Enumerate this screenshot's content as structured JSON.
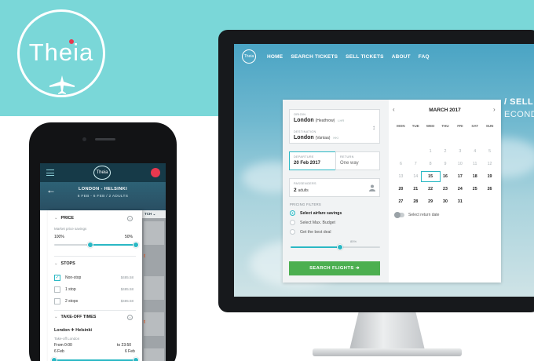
{
  "brand": {
    "logo_text": "Theia",
    "accent": "#2ab8c4",
    "band": "#7ad7d8",
    "cta": "#4caf50"
  },
  "desktop": {
    "nav": [
      "HOME",
      "SEARCH TICKETS",
      "SELL TICKETS",
      "ABOUT",
      "FAQ"
    ],
    "nav_logo": "Theia",
    "hero_line1": "/ SELL",
    "hero_line2": "ECONDA",
    "origin": {
      "label": "ORIGIN",
      "city": "London",
      "airport": "(Heathrow)",
      "code": "LHR"
    },
    "destination": {
      "label": "DESTINATION",
      "city": "London",
      "airport": "(Vantaa)",
      "code": "HKI"
    },
    "departure": {
      "label": "DEPARTURE",
      "value": "20 Feb 2017"
    },
    "return": {
      "label": "RETURN",
      "value": "One way"
    },
    "passengers": {
      "label": "PASSENGERS",
      "count": "2",
      "unit": "adults"
    },
    "pricing": {
      "label": "PRICING FILTERS",
      "options": [
        "Select airfare savings",
        "Select Max. Budget",
        "Get the best deal"
      ],
      "selected_index": 0,
      "slider_label": "85%",
      "slider_value": 0.55
    },
    "search_button": "SEARCH FLIGHTS",
    "calendar": {
      "title": "MARCH 2017",
      "weekdays": [
        "MON",
        "TUE",
        "WED",
        "THU",
        "FRI",
        "SAT",
        "SUN"
      ],
      "rows": [
        [
          "",
          "",
          "",
          "",
          "",
          "",
          ""
        ],
        [
          "",
          "",
          "1",
          "2",
          "3",
          "4",
          "5"
        ],
        [
          "6",
          "7",
          "8",
          "9",
          "10",
          "11",
          "12"
        ],
        [
          "13",
          "14",
          "15",
          "16",
          "17",
          "18",
          "19"
        ],
        [
          "20",
          "21",
          "22",
          "23",
          "24",
          "25",
          "26"
        ],
        [
          "27",
          "28",
          "29",
          "30",
          "31",
          "",
          ""
        ]
      ],
      "selected": "15",
      "past_through": 14,
      "return_toggle_label": "Select return date"
    }
  },
  "mobile": {
    "logo": "Theia",
    "route": "LONDON - HELSINKI",
    "dates": "6 FEB - 6 FEB / 2 ADULTS",
    "side_tab": "TCH",
    "price": {
      "title": "PRICE",
      "subtitle": "Market price savings",
      "min": "100%",
      "max": "50%"
    },
    "stops": {
      "title": "STOPS",
      "items": [
        {
          "label": "Non-stop",
          "price": "$485.58",
          "checked": true
        },
        {
          "label": "1 stop",
          "price": "$485.58",
          "checked": false
        },
        {
          "label": "2 stops",
          "price": "$485.58",
          "checked": false
        }
      ]
    },
    "takeoff": {
      "title": "TAKE-OFF TIMES",
      "route_from": "London",
      "route_to": "Helsinki",
      "sub": "Take-off London",
      "from_label": "From 0:00",
      "from_day": "6 Feb",
      "to_label": "to 23:50",
      "to_day": "6 Feb"
    }
  }
}
